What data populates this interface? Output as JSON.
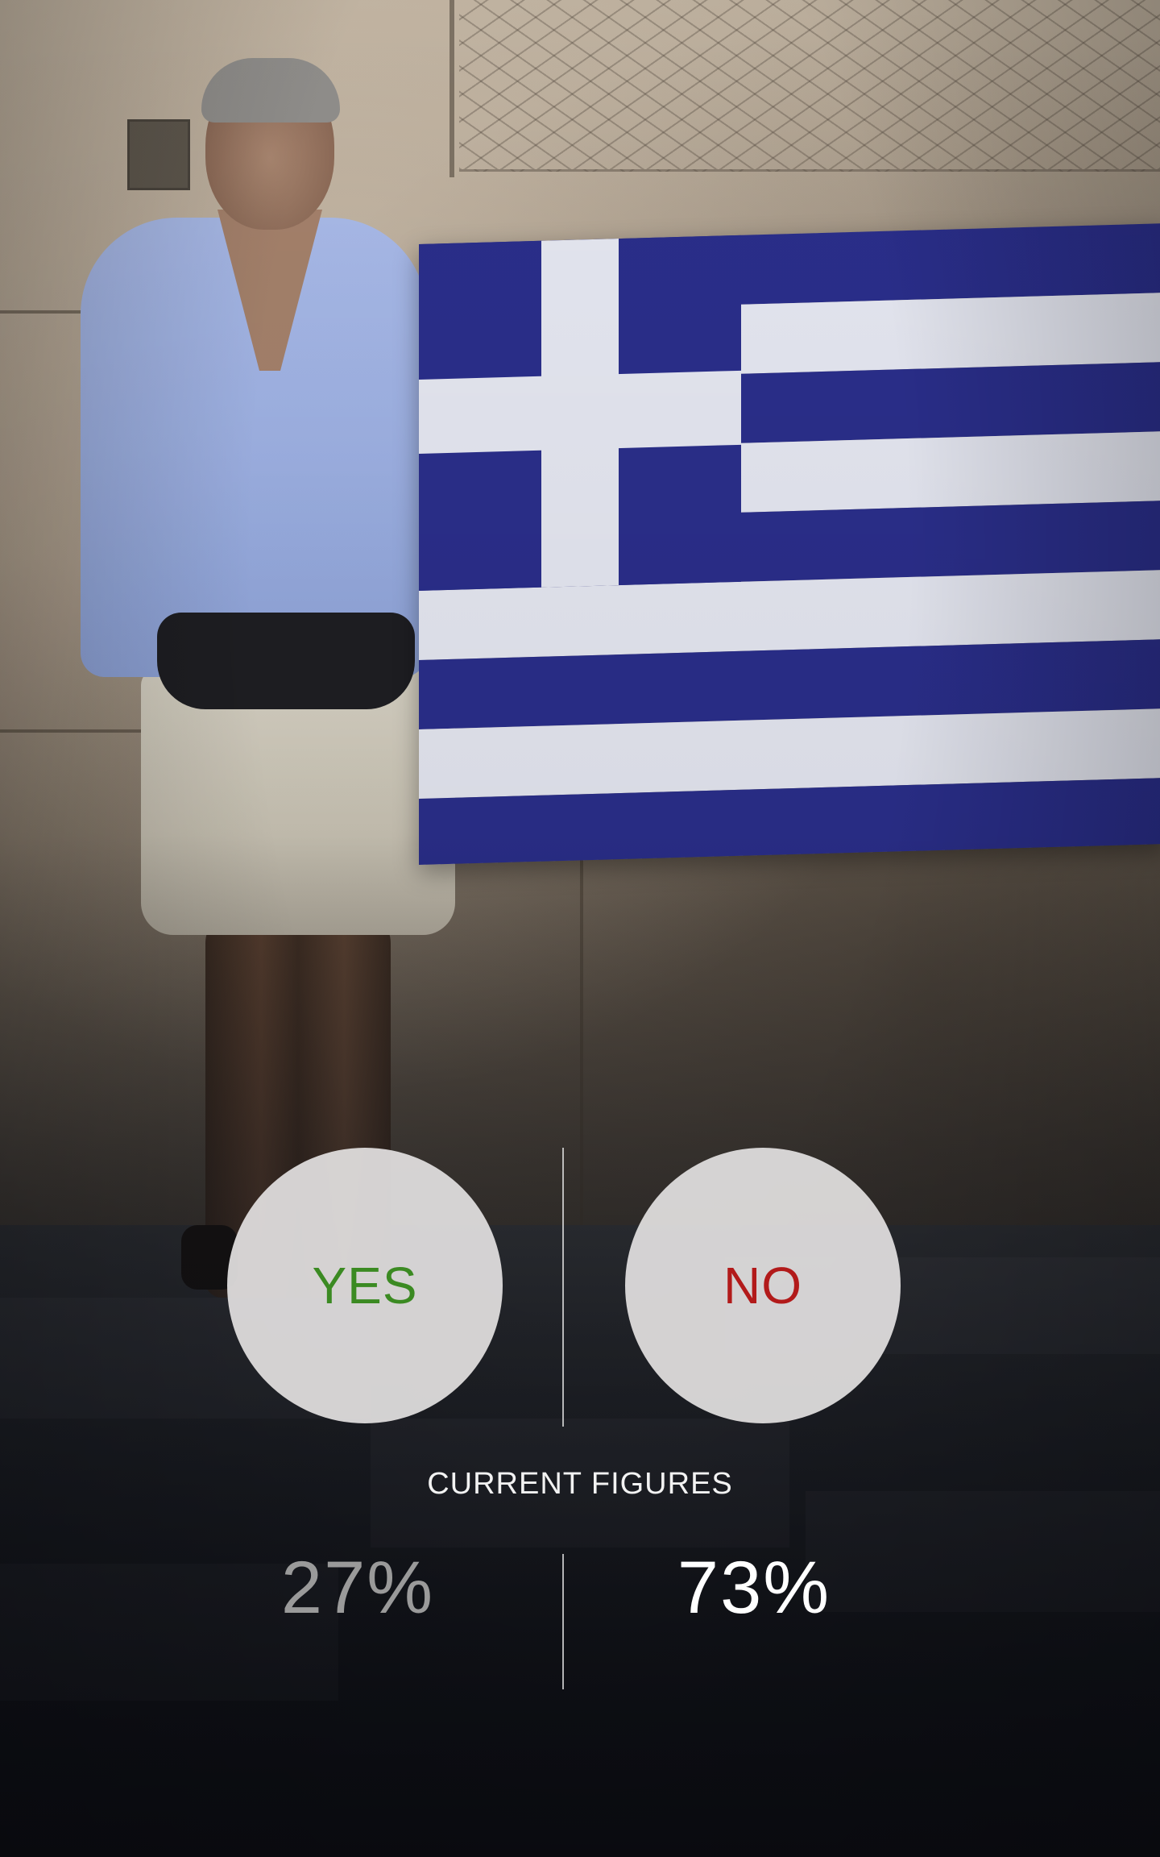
{
  "poll": {
    "yes_label": "YES",
    "no_label": "NO",
    "caption": "CURRENT FIGURES",
    "yes_percent": "27%",
    "no_percent": "73%"
  },
  "colors": {
    "yes_label": "#3b8a22",
    "no_label": "#b21a1a",
    "yes_percent": "#9a9a9a",
    "no_percent": "#ffffff",
    "button_fill": "#e2e0e0",
    "flag_blue": "#2a2e8a",
    "flag_white": "#e4e6f0"
  },
  "results": {
    "yes_fraction": 0.27,
    "no_fraction": 0.73
  }
}
